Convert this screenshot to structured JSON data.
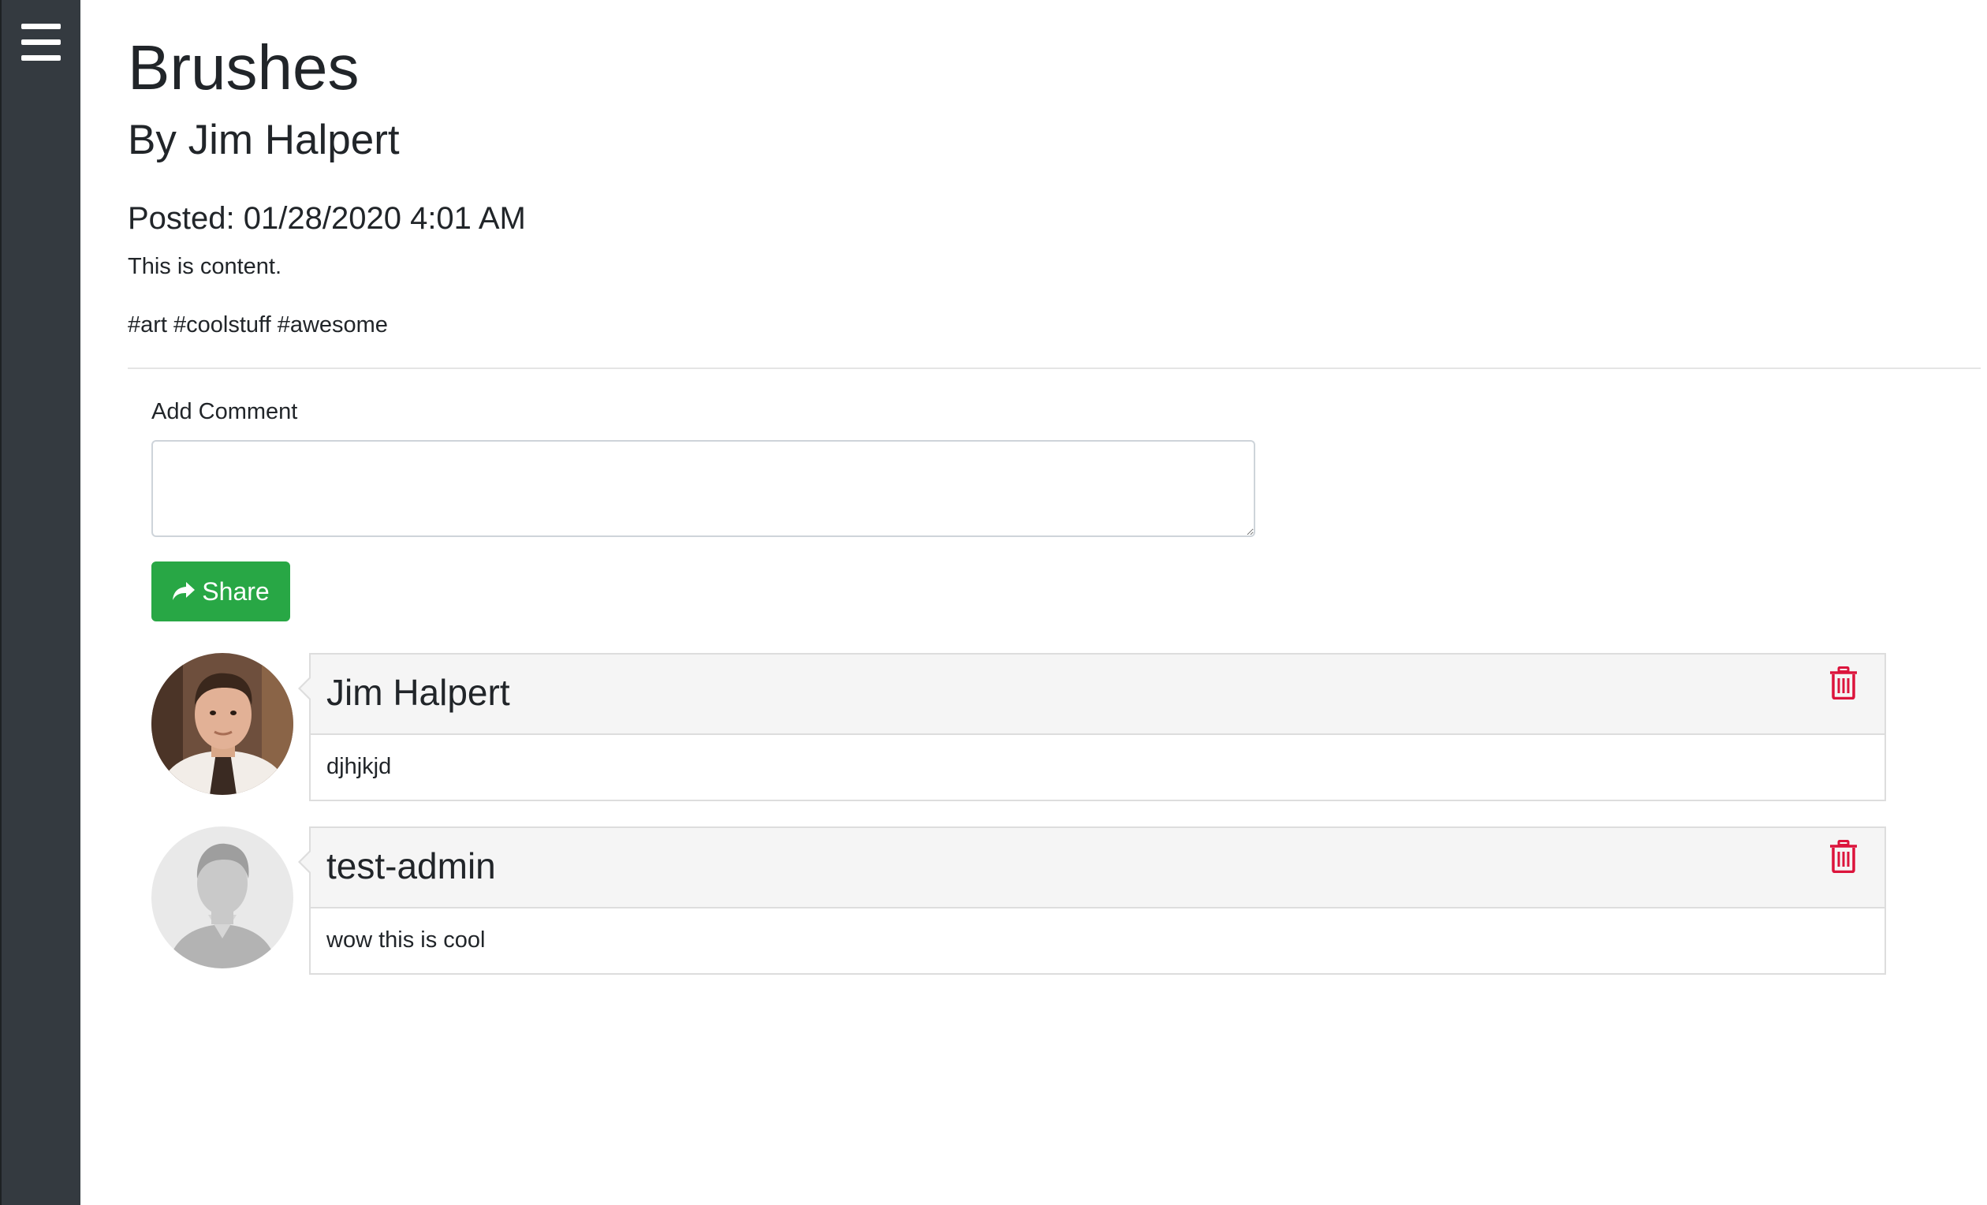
{
  "sidebar": {
    "menu_icon": "hamburger-menu-icon",
    "background_color": "#343a40"
  },
  "post": {
    "title": "Brushes",
    "author_line": "By Jim Halpert",
    "posted_line": "Posted: 01/28/2020 4:01 AM",
    "content": "This is content.",
    "tags": "#art #coolstuff #awesome"
  },
  "comment_form": {
    "label": "Add Comment",
    "textarea_value": "",
    "share_button_label": "Share",
    "share_icon": "share-arrow-icon",
    "share_button_color": "#28a745"
  },
  "comments": [
    {
      "author": "Jim Halpert",
      "body": "djhjkjd",
      "avatar": "user-photo-avatar",
      "delete_icon": "trash-icon"
    },
    {
      "author": "test-admin",
      "body": "wow this is cool",
      "avatar": "default-user-avatar",
      "delete_icon": "trash-icon"
    }
  ],
  "colors": {
    "delete_icon": "#dc143c",
    "comment_heading_bg": "#f5f5f5",
    "panel_border": "#dddddd"
  }
}
